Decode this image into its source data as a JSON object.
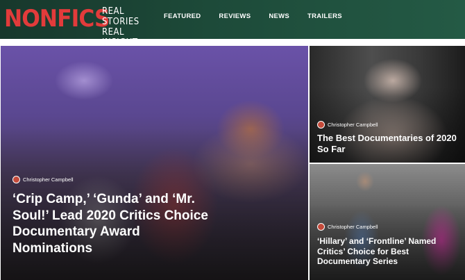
{
  "header": {
    "logo": "NONFICS",
    "tagline": [
      "REAL STORIES",
      "REAL INSIGHT"
    ],
    "nav": [
      "FEATURED",
      "REVIEWS",
      "NEWS",
      "TRAILERS"
    ]
  },
  "colors": {
    "header_bg": "#1d4a39",
    "logo_red": "#e23b3b",
    "text": "#ffffff"
  },
  "articles": [
    {
      "author": "Christopher Campbell",
      "title": "‘Crip Camp,’ ‘Gunda’ and ‘Mr. Soul!’ Lead 2020 Critics Choice Documentary Award Nominations"
    },
    {
      "author": "Christopher Campbell",
      "title": "The Best Documentaries of 2020 So Far"
    },
    {
      "author": "Christopher Campbell",
      "title": "‘Hillary’ and ‘Frontline’ Named Critics’ Choice for Best Documentary Series"
    }
  ]
}
